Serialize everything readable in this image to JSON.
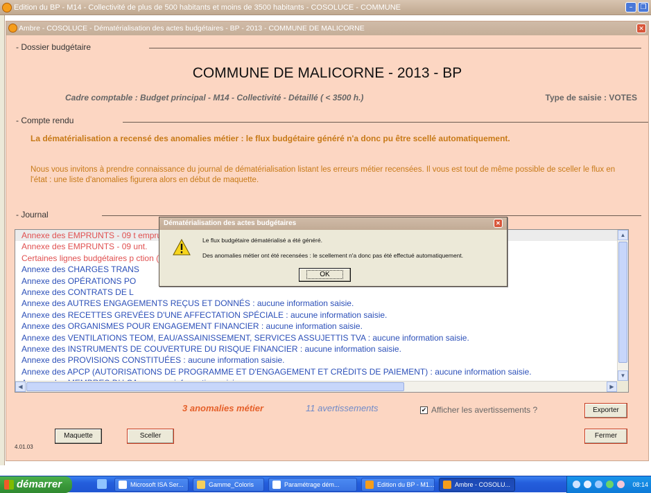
{
  "outer_window": {
    "title": "Edition du BP - M14 - Collectivité de plus de 500 habitants et moins de 3500 habitants - COSOLUCE - COMMUNE"
  },
  "inner_window": {
    "title": "Ambre - COSOLUCE - Dématérialisation des actes budgétaires - BP - 2013 - COMMUNE DE MALICORNE"
  },
  "dossier": {
    "section_label": "- Dossier budgétaire",
    "title": "COMMUNE DE MALICORNE - 2013 - BP",
    "cadre": "Cadre comptable : Budget principal - M14 - Collectivité - Détaillé ( < 3500 h.)",
    "type_saisie": "Type de saisie : VOTES"
  },
  "compte_rendu": {
    "section_label": "- Compte rendu",
    "warning": "La dématérialisation a recensé des anomalies métier : le flux budgétaire généré n'a donc pu être scellé automatiquement.",
    "info": "Nous vous invitons à prendre connaissance du journal de dématérialisation listant les erreurs métier recensées. Il vous est tout de même possible de sceller le flux en l'état : une liste d'anomalies figurera alors en début de maquette."
  },
  "journal": {
    "section_label": "- Journal",
    "rows": [
      {
        "text": "Annexe des EMPRUNTS - 09                                                                                                                       t emprunt.",
        "type": "err"
      },
      {
        "text": "Annexe des EMPRUNTS - 09                                                                                                                       unt.",
        "type": "err"
      },
      {
        "text": "Certaines lignes budgétaires p                                                                                                                 ction (FCT_ASPECT_RE",
        "type": "err"
      },
      {
        "text": "Annexe des CHARGES TRANS",
        "type": "info"
      },
      {
        "text": "Annexe des OPÉRATIONS PO",
        "type": "info"
      },
      {
        "text": "Annexe des CONTRATS DE L",
        "type": "info"
      },
      {
        "text": "Annexe des AUTRES ENGAGEMENTS REÇUS ET DONNÉS : aucune information saisie.",
        "type": "info"
      },
      {
        "text": "Annexe des RECETTES GREVÉES D'UNE AFFECTATION SPÉCIALE : aucune information saisie.",
        "type": "info"
      },
      {
        "text": "Annexe des ORGANISMES POUR ENGAGEMENT FINANCIER : aucune information saisie.",
        "type": "info"
      },
      {
        "text": "Annexe des VENTILATIONS TEOM, EAU/ASSAINISSEMENT, SERVICES ASSUJETTIS TVA : aucune information saisie.",
        "type": "info"
      },
      {
        "text": "Annexe des INSTRUMENTS DE COUVERTURE DU RISQUE FINANCIER : aucune information saisie.",
        "type": "info"
      },
      {
        "text": "Annexe des PROVISIONS CONSTITUÉES : aucune information saisie.",
        "type": "info"
      },
      {
        "text": "Annexe des APCP (AUTORISATIONS DE PROGRAMME ET D'ENGAGEMENT ET CRÉDITS DE PAIEMENT) : aucune information saisie.",
        "type": "info"
      },
      {
        "text": "Annexe des MEMBRES DU CA : aucune information saisie.",
        "type": "info"
      }
    ]
  },
  "summary": {
    "anomalies": "3 anomalies métier",
    "avertissements": "11 avertissements",
    "checkbox_label": "Afficher les avertissements ?",
    "checkbox_mark": "✔",
    "export_button": "Exporter",
    "fermer_button": "Fermer",
    "maquette_button": "Maquette",
    "sceller_button": "Sceller",
    "version": "4.01.03"
  },
  "dialog": {
    "title": "Dématérialisation des actes budgétaires",
    "message1": "Le flux budgétaire dématérialisé a été généré.",
    "message2": "Des anomalies métier ont été recensées : le scellement n'a donc pas été effectué automatiquement.",
    "ok_button": "OK",
    "icon": "warning-icon"
  },
  "taskbar": {
    "start": "démarrer",
    "tasks": [
      {
        "label": "Microsoft ISA Ser...",
        "icon": "isa-icon"
      },
      {
        "label": "Gamme_Coloris",
        "icon": "folder-icon"
      },
      {
        "label": "Paramétrage dém...",
        "icon": "document-icon"
      },
      {
        "label": "Edition du BP - M1...",
        "icon": "app-icon"
      },
      {
        "label": "Ambre - COSOLU...",
        "icon": "app-icon"
      }
    ],
    "clock": "08:14"
  },
  "colors": {
    "panel_bg": "#fcd6c2",
    "warning_orange": "#c77a18",
    "error_red": "#e05050",
    "info_blue": "#2b4fb8"
  }
}
